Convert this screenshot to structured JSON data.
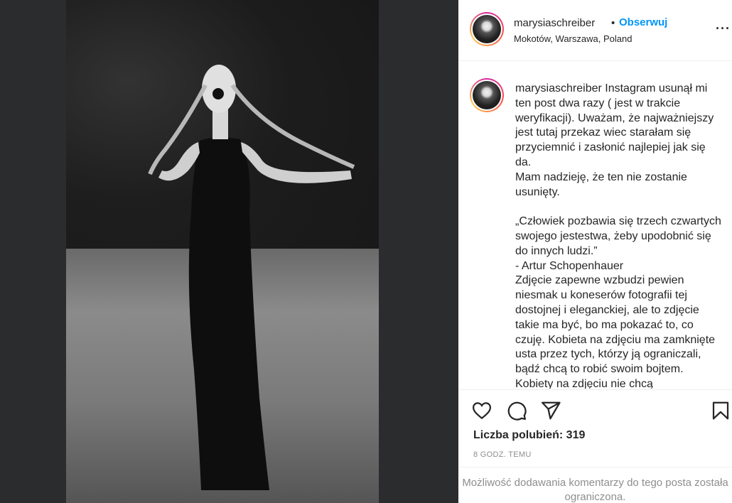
{
  "post": {
    "username": "marysiaschreiber",
    "separator": "•",
    "follow_label": "Obserwuj",
    "location": "Mokotów, Warszawa, Poland",
    "more_label": "···"
  },
  "caption": {
    "username": "marysiaschreiber",
    "text": " Instagram usunął mi ten post dwa razy ( jest w trakcie weryfikacji). Uważam, że najważniejszy jest tutaj przekaz wiec starałam się przyciemnić i zasłonić najlepiej jak się da.\nMam nadzieję, że ten nie zostanie usunięty.\n\n„Człowiek pozbawia się trzech czwartych swojego jestestwa, żeby upodobnić się do innych ludzi.”\n- Artur Schopenhauer\nZdjęcie zapewne wzbudzi pewien niesmak u koneserów fotografii tej dostojnej i eleganckiej, ale to zdjęcie takie ma być, bo ma pokazać to, co czuję. Kobieta na zdjęciu ma zamknięte usta przez tych, którzy ją ograniczali, bądź chcą to robić swoim bojtem. Kobiety na zdjęciu nie chcą"
  },
  "actions": {
    "like_icon": "heart-icon",
    "comment_icon": "comment-icon",
    "share_icon": "paper-plane-icon",
    "save_icon": "bookmark-icon"
  },
  "likes_text": "Liczba polubień: 319",
  "time_text": "8 GODZ. TEMU",
  "comments_disabled_text": "Możliwość dodawania komentarzy do tego posta została ograniczona.",
  "colors": {
    "link_blue": "#0095f6",
    "text": "#262626",
    "muted": "#8e8e8e",
    "left_background": "#2b2c2e"
  }
}
